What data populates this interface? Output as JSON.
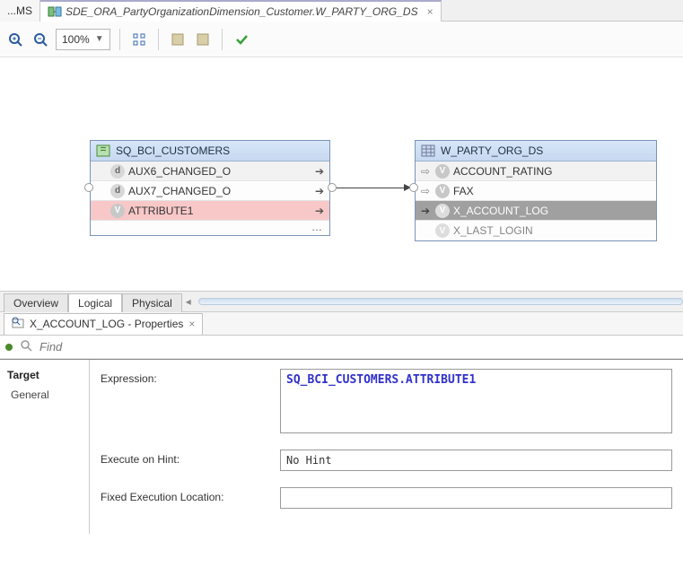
{
  "tabs": {
    "prev_label": "...MS",
    "active_label": "SDE_ORA_PartyOrganizationDimension_Customer.W_PARTY_ORG_DS"
  },
  "toolbar": {
    "zoom": "100%"
  },
  "canvas": {
    "source": {
      "title": "SQ_BCI_CUSTOMERS",
      "rows": [
        {
          "icon": "d",
          "label": "AUX6_CHANGED_O"
        },
        {
          "icon": "d",
          "label": "AUX7_CHANGED_O"
        },
        {
          "icon": "v",
          "label": "ATTRIBUTE1"
        }
      ]
    },
    "target": {
      "title": "W_PARTY_ORG_DS",
      "rows": [
        {
          "icon": "v",
          "label": "ACCOUNT_RATING"
        },
        {
          "icon": "v",
          "label": "FAX"
        },
        {
          "icon": "v",
          "label": "X_ACCOUNT_LOG"
        },
        {
          "icon": "v",
          "label": "X_LAST_LOGIN"
        }
      ]
    }
  },
  "view_tabs": {
    "overview": "Overview",
    "logical": "Logical",
    "physical": "Physical"
  },
  "properties": {
    "tab_title": "X_ACCOUNT_LOG - Properties",
    "find_placeholder": "Find",
    "section_title": "Target",
    "section_item_general": "General",
    "labels": {
      "expression": "Expression:",
      "execute_hint": "Execute on Hint:",
      "fixed_location": "Fixed Execution Location:"
    },
    "values": {
      "expression": "SQ_BCI_CUSTOMERS.ATTRIBUTE1",
      "execute_hint": "No Hint",
      "fixed_location": ""
    }
  }
}
